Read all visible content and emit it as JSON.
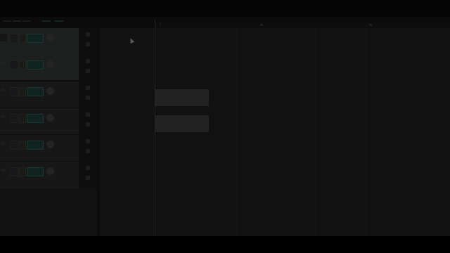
{
  "tracks": [
    {
      "name": "m",
      "selected": true,
      "record_label": "on"
    },
    {
      "name": "dx",
      "selected": false,
      "record_label": "on"
    },
    {
      "name": "m",
      "selected": false,
      "record_label": "on"
    },
    {
      "name": "m",
      "selected": false,
      "record_label": "on"
    },
    {
      "name": "m",
      "selected": false,
      "record_label": "on"
    },
    {
      "name": "dx",
      "selected": false,
      "record_label": "on"
    }
  ],
  "timeline": {
    "ruler_label": "1"
  },
  "colors": {
    "background": "#000000",
    "panel": "#171717",
    "selected_track": "#1b1f1d",
    "clip": "#222222",
    "accent_green": "#0f2420"
  }
}
